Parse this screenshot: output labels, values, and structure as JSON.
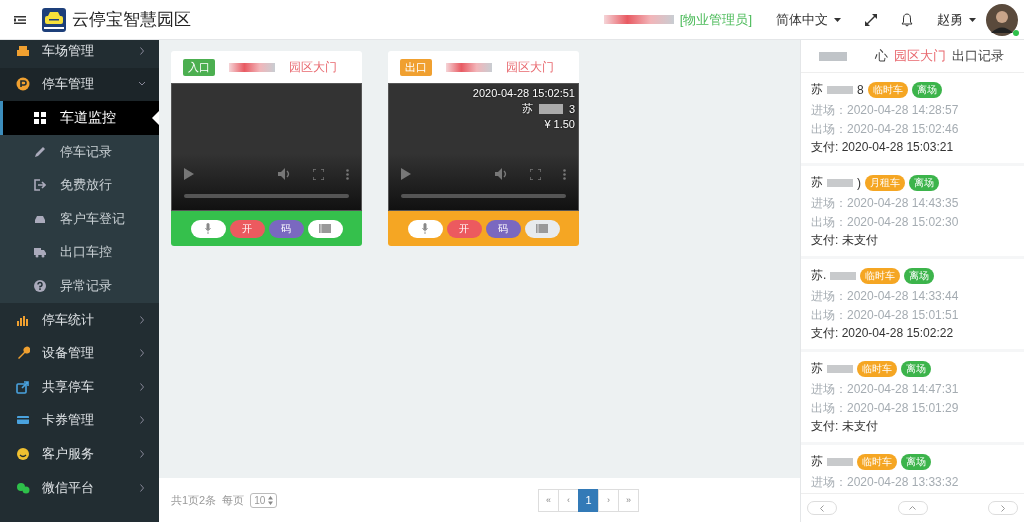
{
  "header": {
    "title": "云停宝智慧园区",
    "role": "[物业管理员]",
    "language": "简体中文",
    "user": "赵勇",
    "online": true
  },
  "sidebar": {
    "items": [
      {
        "label": "车场管理",
        "expanded": false
      },
      {
        "label": "停车管理",
        "expanded": true,
        "children": [
          {
            "label": "车道监控",
            "selected": true
          },
          {
            "label": "停车记录",
            "selected": false
          },
          {
            "label": "免费放行",
            "selected": false
          },
          {
            "label": "客户车登记",
            "selected": false
          },
          {
            "label": "出口车控",
            "selected": false
          },
          {
            "label": "异常记录",
            "selected": false
          }
        ]
      },
      {
        "label": "停车统计",
        "expanded": false
      },
      {
        "label": "设备管理",
        "expanded": false
      },
      {
        "label": "共享停车",
        "expanded": false
      },
      {
        "label": "卡券管理",
        "expanded": false
      },
      {
        "label": "客户服务",
        "expanded": false
      },
      {
        "label": "微信平台",
        "expanded": false
      }
    ]
  },
  "cameras": [
    {
      "kind": "entrance",
      "tag": "入口",
      "name": "园区大门",
      "buttons": [
        {
          "kind": "mic"
        },
        {
          "kind": "open",
          "label": "开"
        },
        {
          "kind": "code",
          "label": "码"
        },
        {
          "kind": "list"
        }
      ]
    },
    {
      "kind": "exit",
      "tag": "出口",
      "name": "园区大门",
      "overlay": [
        "2020-04-28 15:02:51",
        "苏",
        "3",
        "¥ 1.50"
      ],
      "buttons": [
        {
          "kind": "mic"
        },
        {
          "kind": "open",
          "label": "开"
        },
        {
          "kind": "code",
          "label": "码"
        },
        {
          "kind": "list"
        }
      ]
    }
  ],
  "pagination": {
    "summary": "共1页2条",
    "per_page_label": "每页",
    "per_page": "10",
    "pages": [
      {
        "label": "«",
        "selected": false
      },
      {
        "label": "‹",
        "selected": false
      },
      {
        "label": "1",
        "selected": true
      },
      {
        "label": "›",
        "selected": false
      },
      {
        "label": "»",
        "selected": false
      }
    ]
  },
  "records_panel": {
    "title_prefix": "心",
    "gate": "园区大门",
    "title": "出口记录",
    "records": [
      {
        "plate": "苏",
        "plate_suffix": "8",
        "tags": [
          {
            "label": "临时车",
            "color": "#f5a623"
          },
          {
            "label": "离场",
            "color": "#3cb44b"
          }
        ],
        "lines": [
          {
            "kind": "time",
            "text": "进场：2020-04-28 14:28:57"
          },
          {
            "kind": "time",
            "text": "出场：2020-04-28 15:02:46"
          },
          {
            "kind": "payment",
            "text": "支付: 2020-04-28 15:03:21"
          }
        ]
      },
      {
        "plate": "苏",
        "plate_suffix": ")",
        "tags": [
          {
            "label": "月租车",
            "color": "#f5a623"
          },
          {
            "label": "离场",
            "color": "#3cb44b"
          }
        ],
        "lines": [
          {
            "kind": "time",
            "text": "进场：2020-04-28 14:43:35"
          },
          {
            "kind": "time",
            "text": "出场：2020-04-28 15:02:30"
          },
          {
            "kind": "payment",
            "text": "支付: 未支付"
          }
        ]
      },
      {
        "plate": "苏.",
        "tags": [
          {
            "label": "临时车",
            "color": "#f5a623"
          },
          {
            "label": "离场",
            "color": "#3cb44b"
          }
        ],
        "lines": [
          {
            "kind": "time",
            "text": "进场：2020-04-28 14:33:44"
          },
          {
            "kind": "time",
            "text": "出场：2020-04-28 15:01:51"
          },
          {
            "kind": "payment",
            "text": "支付: 2020-04-28 15:02:22"
          }
        ]
      },
      {
        "plate": "苏",
        "tags": [
          {
            "label": "临时车",
            "color": "#f5a623"
          },
          {
            "label": "离场",
            "color": "#3cb44b"
          }
        ],
        "lines": [
          {
            "kind": "time",
            "text": "进场：2020-04-28 14:47:31"
          },
          {
            "kind": "time",
            "text": "出场：2020-04-28 15:01:29"
          },
          {
            "kind": "payment",
            "text": "支付: 未支付"
          }
        ]
      },
      {
        "plate": "苏",
        "tags": [
          {
            "label": "临时车",
            "color": "#f5a623"
          },
          {
            "label": "离场",
            "color": "#3cb44b"
          }
        ],
        "lines": [
          {
            "kind": "time",
            "text": "进场：2020-04-28 13:33:32"
          }
        ]
      }
    ]
  }
}
